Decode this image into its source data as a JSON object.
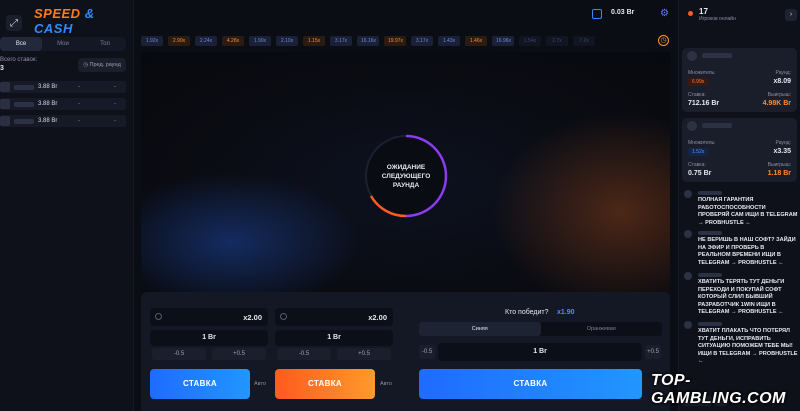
{
  "brand": {
    "speed": "SPEED",
    "cash": "CASH"
  },
  "left": {
    "tabs": [
      {
        "label": "Все"
      },
      {
        "label": "Мои"
      },
      {
        "label": "Топ"
      }
    ],
    "stats_label": "Всего ставок:",
    "stats_value": "3",
    "prev_round": "Пред. раунд",
    "bets": [
      {
        "amount": "3.88 Br",
        "mult": "-",
        "win": "-"
      },
      {
        "amount": "3.88 Br",
        "mult": "-",
        "win": "-"
      },
      {
        "amount": "3.88 Br",
        "mult": "-",
        "win": "-"
      }
    ]
  },
  "topbar": {
    "balance": "0.03 Br"
  },
  "history": [
    {
      "v": "1.92x",
      "c": "b"
    },
    {
      "v": "2.90x",
      "c": "o"
    },
    {
      "v": "2.24x",
      "c": "b"
    },
    {
      "v": "4.28x",
      "c": "o"
    },
    {
      "v": "1.90x",
      "c": "b"
    },
    {
      "v": "2.10x",
      "c": "b"
    },
    {
      "v": "1.15x",
      "c": "o"
    },
    {
      "v": "3.17x",
      "c": "b"
    },
    {
      "v": "16.16x",
      "c": "b"
    },
    {
      "v": "19.97x",
      "c": "o"
    },
    {
      "v": "3.17x",
      "c": "b"
    },
    {
      "v": "1.43x",
      "c": "b"
    },
    {
      "v": "1.46x",
      "c": "o"
    },
    {
      "v": "16.96x",
      "c": "b"
    },
    {
      "v": "1.54x",
      "c": "b"
    },
    {
      "v": "2.7x",
      "c": "b"
    },
    {
      "v": "7.2x",
      "c": "b"
    }
  ],
  "game": {
    "waiting": "ОЖИДАНИЕ СЛЕДУЮЩЕГО РАУНДА"
  },
  "panel": {
    "blue": {
      "mult": "x2.00",
      "amount": "1 Br",
      "minus": "-0.5",
      "plus": "+0.5",
      "button": "СТАВКА",
      "auto": "Авто"
    },
    "orange": {
      "mult": "x2.00",
      "amount": "1 Br",
      "minus": "-0.5",
      "plus": "+0.5",
      "button": "СТАВКА",
      "auto": "Авто"
    },
    "side": {
      "question": "Кто победит?",
      "coef": "x1.90",
      "tab_blue": "Синяя",
      "tab_orange": "Оранжевая",
      "amount": "1 Br",
      "minus": "-0.5",
      "plus": "+0.5",
      "button": "СТАВКА"
    }
  },
  "right": {
    "online_count": "17",
    "online_label": "Игроков онлайн",
    "cards": [
      {
        "mult_label": "Множитель:",
        "mult": "6.99x",
        "round_label": "Раунд:",
        "round": "x8.09",
        "bet_label": "Ставка:",
        "bet": "712.16 Br",
        "win_label": "Выигрыш:",
        "win": "4.98K Br",
        "badge_color": "#ff5a1f",
        "win_color": "#ff8a33"
      },
      {
        "mult_label": "Множитель:",
        "mult": "1.52x",
        "round_label": "Раунд:",
        "round": "x3.35",
        "bet_label": "Ставка:",
        "bet": "0.75 Br",
        "win_label": "Выигрыш:",
        "win": "1.18 Br",
        "badge_color": "#2f8bff",
        "win_color": "#ff8a33"
      }
    ],
    "messages": [
      "ПОЛНАЯ ГАРАНТИЯ РАБОТОСПОСОБНОСТИ ПРОВЕРЯЙ САМ ИЩИ В TELEGRAM → PROBHUSTLE ←",
      "НЕ ВЕРИШЬ В НАШ СОФТ? ЗАЙДИ НА ЭФИР И ПРОВЕРЬ В РЕАЛЬНОМ ВРЕМЕНИ ИЩИ В TELEGRAM → PROBHUSTLE ←",
      "ХВАТИТЬ ТЕРЯТЬ ТУТ ДЕНЬГИ ПЕРЕХОДИ И ПОКУПАЙ СОФТ КОТОРЫЙ СЛИЛ БЫВШИЙ РАЗРАБОТЧИК 1WIN ИЩИ В TELEGRAM → PROBHUSTLE ←",
      "ХВАТИТ ПЛАКАТЬ ЧТО ПОТЕРЯЛ ТУТ ДЕНЬГИ, ИСПРАВИТЬ СИТУАЦИЮ ПОМОЖЕМ ТЕБЕ МЫ! ИЩИ В TELEGRAM → PROBHUSTLE ←"
    ]
  },
  "watermark": "TOP-GAMBLING.COM"
}
